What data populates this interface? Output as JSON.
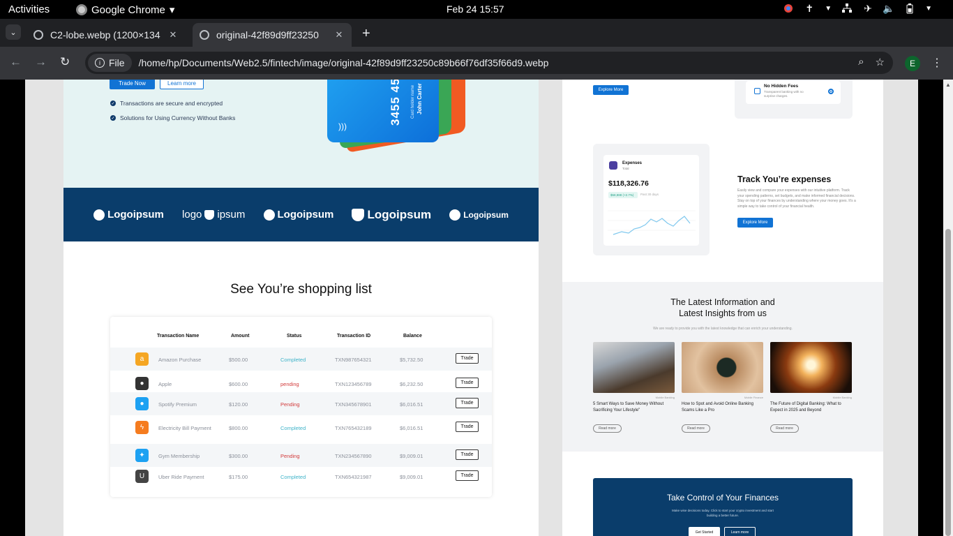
{
  "system": {
    "activities": "Activities",
    "app_name": "Google Chrome",
    "clock": "Feb 24  15:57"
  },
  "browser": {
    "tabs": [
      {
        "title": "C2-lobe.webp (1200×134",
        "active": false
      },
      {
        "title": "original-42f89d9ff23250",
        "active": true
      }
    ],
    "chip_label": "File",
    "url": "/home/hp/Documents/Web2.5/fintech/image/original-42f89d9ff23250c89b66f76df35f66d9.webp",
    "profile_initial": "E"
  },
  "left": {
    "trade_now": "Trade Now",
    "learn_more": "Learn more",
    "checks": [
      "Transactions are secure and encrypted",
      "Solutions for Using Currency Without Banks"
    ],
    "card": {
      "number": "3455 45",
      "holder_label": "Card holder name",
      "holder": "John Carter"
    },
    "logos": [
      "Logoipsum",
      "logo",
      "ipsum",
      "Logoipsum",
      "Logoipsum",
      "Logoipsum"
    ],
    "shopping_title": "See You’re shopping list",
    "table": {
      "headers": [
        "Transaction Name",
        "Amount",
        "Status",
        "Transaction ID",
        "Balance"
      ],
      "rows": [
        {
          "name": "Amazon Purchase",
          "amount": "$500.00",
          "status": "Completed",
          "id": "TXN987654321",
          "balance": "$5,732.50",
          "action": "Trade",
          "icon": "amazon-icon",
          "color": "#f5a623",
          "glyph": "a"
        },
        {
          "name": "Apple",
          "amount": "$600.00",
          "status": "pending",
          "id": "TXN123456789",
          "balance": "$6,232.50",
          "action": "Trade",
          "icon": "apple-icon",
          "color": "#333333",
          "glyph": "●"
        },
        {
          "name": "Spotify Premium",
          "amount": "$120.00",
          "status": "Pending",
          "id": "TXN345678901",
          "balance": "$6,016.51",
          "action": "Trade",
          "icon": "spotify-icon",
          "color": "#1da1f2",
          "glyph": "●"
        },
        {
          "name": "Electricity Bill Payment",
          "amount": "$800.00",
          "status": "Completed",
          "id": "TXN765432189",
          "balance": "$6,016.51",
          "action": "Trade",
          "icon": "lightning-icon",
          "color": "#f57c1f",
          "glyph": "ϟ"
        },
        {
          "name": "Gym Membership",
          "amount": "$300.00",
          "status": "Pending",
          "id": "TXN234567890",
          "balance": "$9,009.01",
          "action": "Trade",
          "icon": "gym-icon",
          "color": "#1da1f2",
          "glyph": "✦"
        },
        {
          "name": "Uber Ride Payment",
          "amount": "$175.00",
          "status": "Completed",
          "id": "TXN654321987",
          "balance": "$9,009.01",
          "action": "Trade",
          "icon": "uber-icon",
          "color": "#444444",
          "glyph": "U"
        }
      ]
    }
  },
  "right": {
    "explore_more": "Explore More",
    "fees_title": "No Hidden Fees",
    "fees_sub": "Transparent banking with no surprise charges.",
    "expenses": {
      "title": "Expenses",
      "sub": "Total",
      "amount": "$118,326.76",
      "delta": "$58,888 (+2.7%)",
      "delta_note": "Past 30 days"
    },
    "track_title": "Track You’re expenses",
    "track_body": "Easily view and compare your expenses with our intuitive platform. Track your spending patterns, set budgets, and make informed financial decisions. Stay on top of your finances by understanding where your money goes. It’s a simple way to take control of your financial health.",
    "latest_title_1": "The Latest Information and",
    "latest_title_2": "Latest Insights from us",
    "latest_sub": "We are ready to provide you with the latest knowledge that can enrich your understanding.",
    "posts": [
      {
        "category": "Mobile Banking",
        "title": "5 Smart Ways to Save Money Without Sacrificing Your Lifestyle\"",
        "read": "Read more"
      },
      {
        "category": "Mobile Finance",
        "title": "How to Spot and Avoid Online Banking Scams Like a Pro",
        "read": "Read more"
      },
      {
        "category": "Mobile Banking",
        "title": "The Future of Digital Banking: What to Expect in 2025 and Beyond",
        "read": "Read more"
      }
    ],
    "cta": {
      "title": "Take Control of Your Finances",
      "body": "Make wise decisions today. Click to start your crypto investment and start building a better future.",
      "get_started": "Get Started",
      "learn_more": "Learn more"
    }
  }
}
